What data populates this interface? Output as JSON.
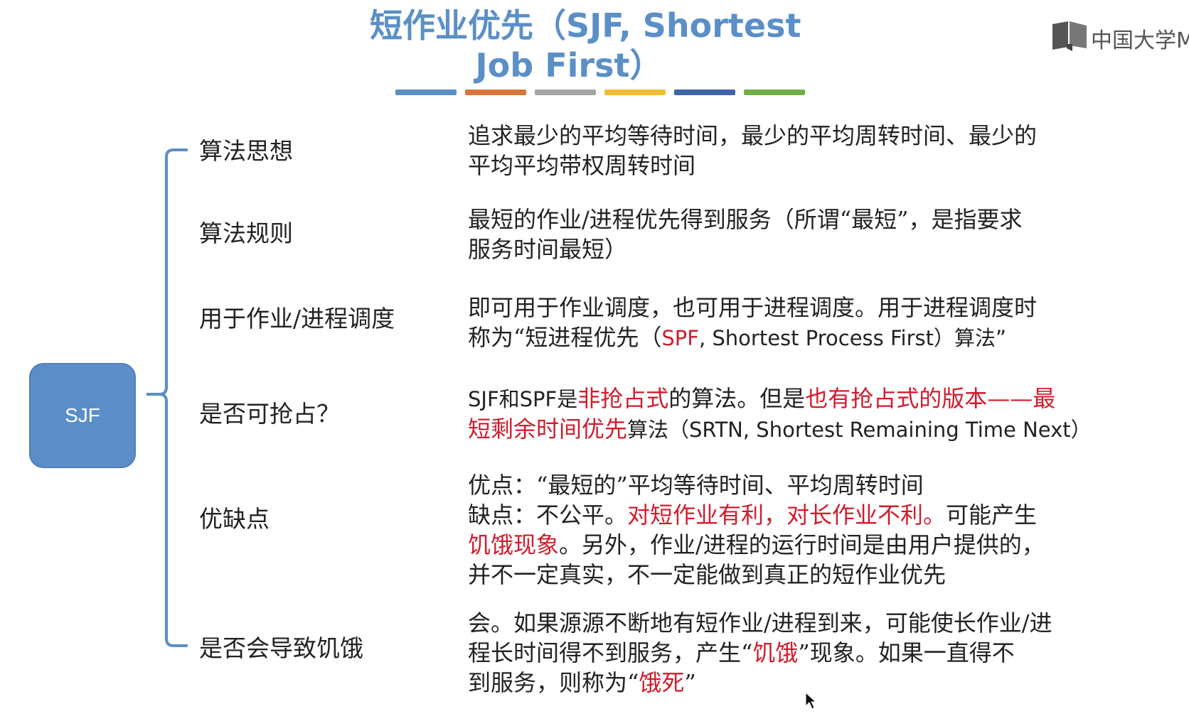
{
  "title": {
    "line1": "短作业优先（SJF, Shortest",
    "line2": "Job First）"
  },
  "title_bar_colors": [
    "#5b8fc7",
    "#d9743a",
    "#a5a5a5",
    "#f2bd34",
    "#3e64a8",
    "#6faf45"
  ],
  "logo": {
    "text": "中国大学M",
    "icon": "book-icon"
  },
  "root_node": {
    "label": "SJF"
  },
  "rows": [
    {
      "label": "算法思想",
      "lines": [
        "追求最少的平均等待时间，最少的平均周转时间、最少的",
        "平均平均带权周转时间"
      ]
    },
    {
      "label": "算法规则",
      "lines": [
        "最短的作业/进程优先得到服务（所谓“最短”，是指要求",
        "服务时间最短）"
      ]
    },
    {
      "label": "用于作业/进程调度",
      "line1": "即可用于作业调度，也可用于进程调度。用于进程调度时",
      "line2_a": "称为“短进程优先（",
      "line2_red": "SPF",
      "line2_b": ", Shortest Process First）算法”"
    },
    {
      "label": "是否可抢占？",
      "l1_a": "SJF和SPF是",
      "l1_red1": "非抢占式",
      "l1_b": "的算法。但是",
      "l1_red2": "也有抢占式的版本——最",
      "l2_red": "短剩余时间优先",
      "l2_a": "算法（SRTN, Shortest Remaining Time Next）"
    },
    {
      "label": "优缺点",
      "line1": "优点：“最短的”平均等待时间、平均周转时间",
      "line2_a": "缺点：不公平。",
      "line2_red": "对短作业有利，对长作业不利。",
      "line2_b": "可能产生",
      "line3_red": "饥饿现象",
      "line3_a": "。另外，作业/进程的运行时间是由用户提供的，",
      "line4": "并不一定真实，不一定能做到真正的短作业优先"
    },
    {
      "label": "是否会导致饥饿",
      "line1": "会。如果源源不断地有短作业/进程到来，可能使长作业/进",
      "line2_a": "程长时间得不到服务，产生“",
      "line2_red": "饥饿",
      "line2_b": "”现象。如果一直得不",
      "line3_a": "到服务，则称为“",
      "line3_red": "饿死",
      "line3_b": "”"
    }
  ],
  "colors": {
    "accent_blue": "#5b8ec8",
    "emphasis_red": "#d01c2c"
  }
}
